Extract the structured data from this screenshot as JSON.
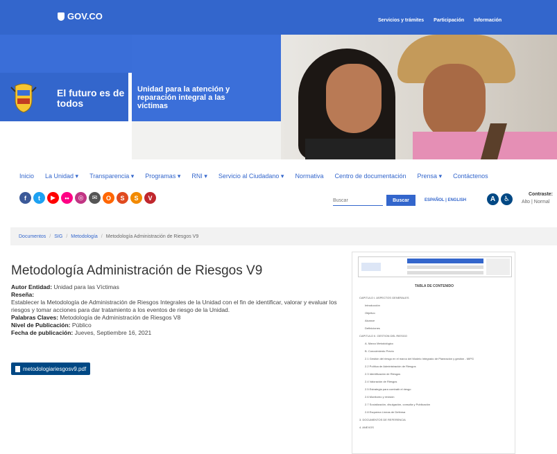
{
  "topbar": {
    "logo_text": "GOV.CO",
    "links": [
      "Servicios y trámites",
      "Participación",
      "Información"
    ]
  },
  "banner": {
    "slogan": "El futuro es de todos",
    "unit": "Unidad para la atención y reparación integral a las víctimas"
  },
  "nav": {
    "items": [
      "Inicio",
      "La Unidad ▾",
      "Transparencia ▾",
      "Programas ▾",
      "RNI ▾",
      "Servicio al Ciudadano ▾",
      "Normativa",
      "Centro de documentación",
      "Prensa ▾",
      "Contáctenos"
    ]
  },
  "social": {
    "icons": [
      {
        "name": "facebook-icon",
        "glyph": "f",
        "color": "#3b5998"
      },
      {
        "name": "twitter-icon",
        "glyph": "t",
        "color": "#1da1f2"
      },
      {
        "name": "youtube-icon",
        "glyph": "▶",
        "color": "#ff0000"
      },
      {
        "name": "flickr-icon",
        "glyph": "••",
        "color": "#ff0084"
      },
      {
        "name": "instagram-icon",
        "glyph": "◎",
        "color": "#c13584"
      },
      {
        "name": "email-icon",
        "glyph": "✉",
        "color": "#555555"
      },
      {
        "name": "orfeo-icon",
        "glyph": "O",
        "color": "#ff6600"
      },
      {
        "name": "sv-icon-1",
        "glyph": "S",
        "color": "#e04a1f"
      },
      {
        "name": "sv-icon-2",
        "glyph": "S",
        "color": "#f28a00"
      },
      {
        "name": "v-icon",
        "glyph": "V",
        "color": "#c0272d"
      }
    ]
  },
  "search": {
    "placeholder": "Buscar",
    "button_label": "Buscar"
  },
  "language": "ESPAÑOL | ENGLISH",
  "accessibility": {
    "contrast_label": "Contraste:",
    "contrast_options": "Alto | Normal"
  },
  "breadcrumb": {
    "items": [
      "Documentos",
      "SIG",
      "Metodología"
    ],
    "current": "Metodología Administración de Riesgos V9"
  },
  "document": {
    "title": "Metodología Administración de Riesgos V9",
    "author_label": "Autor Entidad:",
    "author": "Unidad para las Víctimas",
    "summary_label": "Reseña:",
    "summary": "Establecer la Metodología de Administración de Riesgos Integrales de la Unidad con el fin de identificar, valorar y evaluar los riesgos y tomar acciones para dar tratamiento a los eventos de riesgo de la Unidad.",
    "keywords_label": "Palabras Claves:",
    "keywords": "Metodología de Administración de Riesgos V8",
    "level_label": "Nivel de Publicación:",
    "level": "Público",
    "date_label": "Fecha de publicación:",
    "date": "Jueves, Septiembre 16, 2021",
    "file": "metodologiariesgosv9.pdf"
  },
  "preview": {
    "toc_title": "TABLA DE CONTENIDO",
    "entries": [
      "CAPITULO I. ASPECTOS GENERALES",
      "Introducción",
      "Objetivo",
      "Alcance",
      "Definiciones",
      "CAPITULO II. GESTION DEL RIESGO",
      "A. Marco Metodológico",
      "B. Conocimiento Previo",
      "2.1 Gestión del riesgo en el marco del Modelo Integrado de Planeación y gestión - MIPG",
      "2.2 Política de Administración de Riesgos",
      "2.3 Identificación de Riesgos",
      "2.4 Valoración de Riesgos",
      "2.5 Estrategia para combatir el riesgo",
      "2.6 Monitoreo y revisión",
      "2.7 Socialización, divulgación, consulta y Publicación",
      "2.8 Esquema Líneas de Defensa",
      "3. DOCUMENTOS DE REFERENCIA",
      "4. ANEXOS"
    ]
  }
}
